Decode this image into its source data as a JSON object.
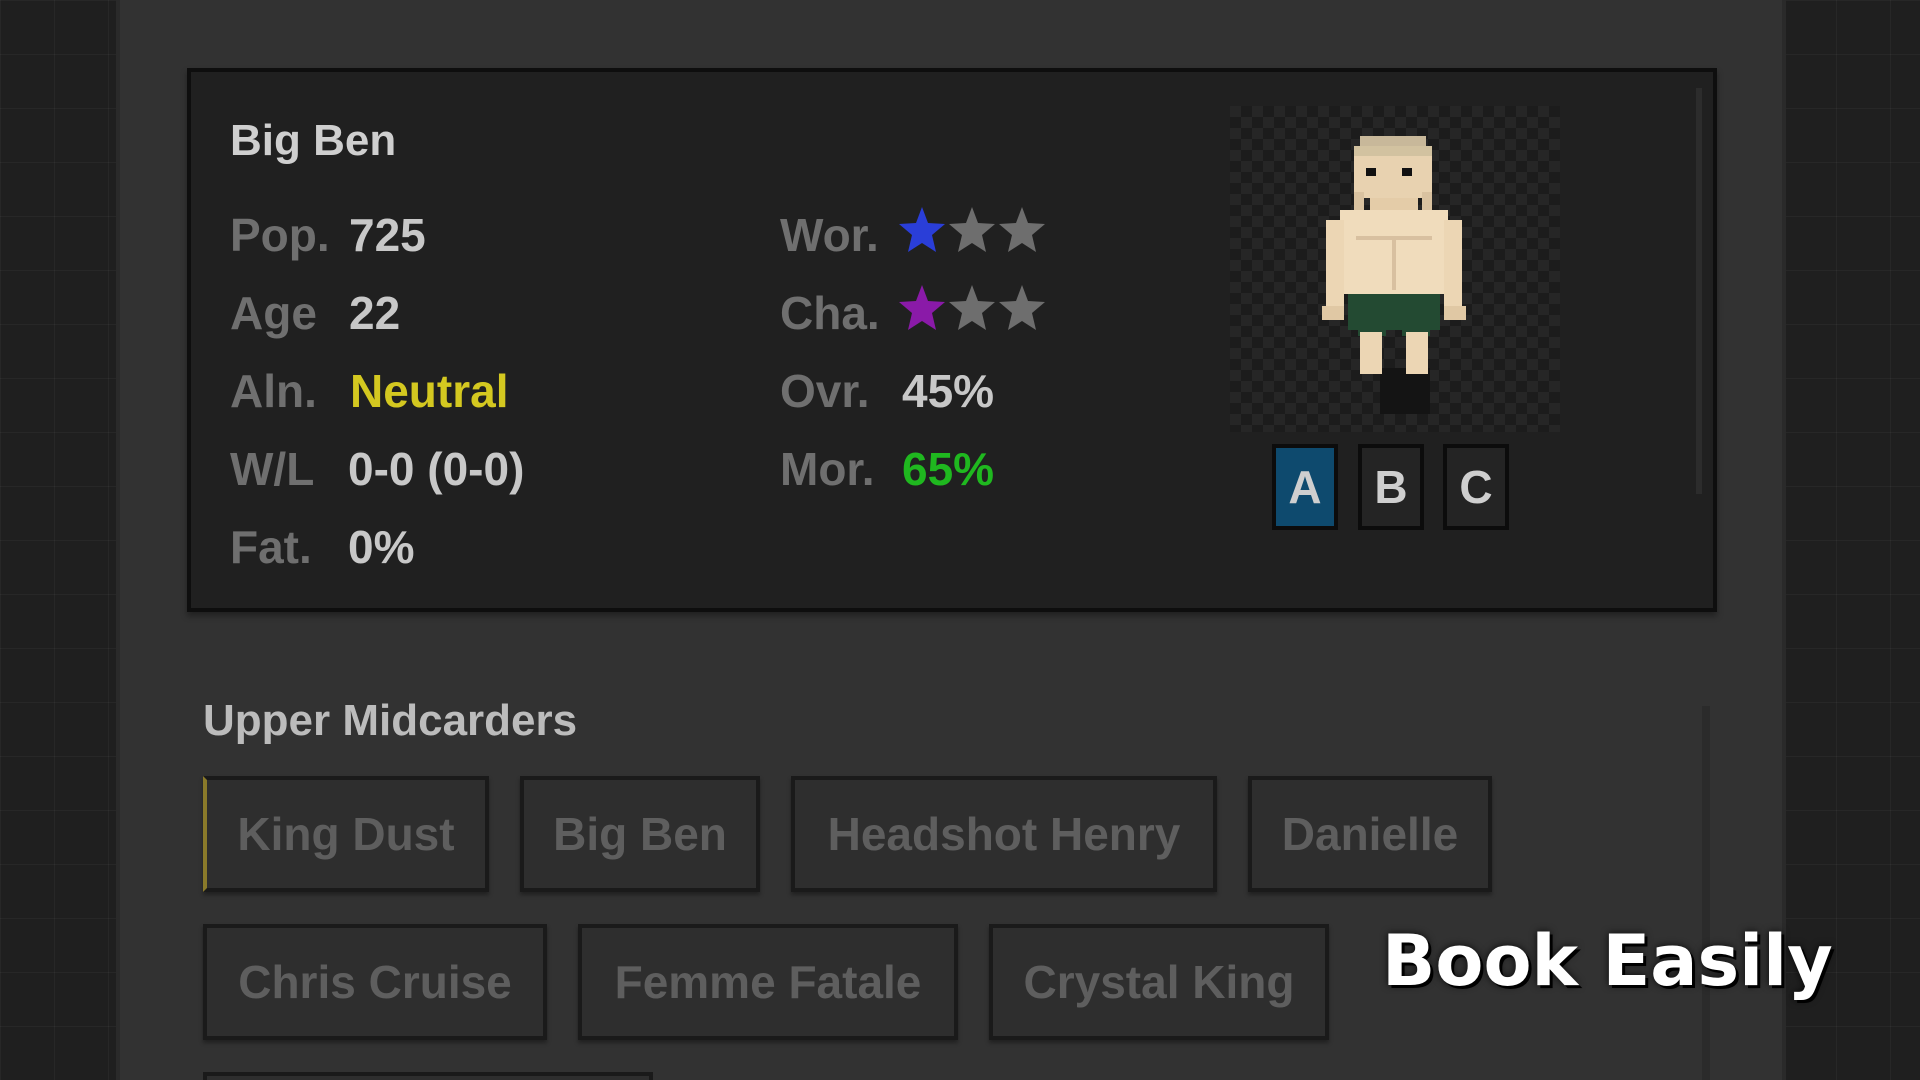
{
  "wrestler": {
    "name": "Big Ben",
    "stats": [
      {
        "label": "Pop.",
        "value": "725"
      },
      {
        "label": "Age",
        "value": "22"
      },
      {
        "label": "Aln.",
        "value": "Neutral",
        "color": "#d4c820"
      },
      {
        "label": "W/L",
        "value": "0-0 (0-0)"
      },
      {
        "label": "Fat.",
        "value": "0%"
      }
    ],
    "ratings": [
      {
        "label": "Wor.",
        "stars_filled": 1,
        "stars_total": 3,
        "star_color": "#2a3ed8"
      },
      {
        "label": "Cha.",
        "stars_filled": 1,
        "stars_total": 3,
        "star_color": "#8a1aa8"
      }
    ],
    "percentages": [
      {
        "label": "Ovr.",
        "value": "45%"
      },
      {
        "label": "Mor.",
        "value": "65%",
        "color": "#1fb81f"
      }
    ],
    "variants": [
      "A",
      "B",
      "C"
    ],
    "active_variant": "A"
  },
  "roster": {
    "section_title": "Upper Midcarders",
    "rows": [
      [
        "King Dust",
        "Big Ben",
        "Headshot Henry",
        "Danielle"
      ],
      [
        "Chris Cruise",
        "Femme Fatale",
        "Crystal King"
      ]
    ]
  },
  "overlay": {
    "text": "Book Easily"
  },
  "colors": {
    "panel_bg": "#323232",
    "card_bg": "#202020",
    "accent_active": "#0e4a6e",
    "empty_star": "#6e6e6e"
  }
}
